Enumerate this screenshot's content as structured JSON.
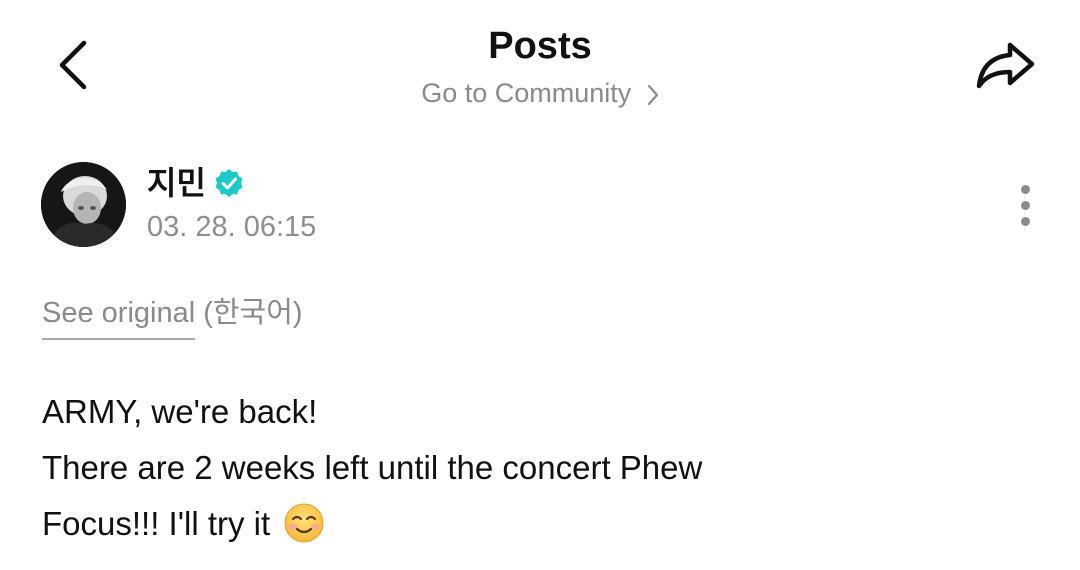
{
  "header": {
    "title": "Posts",
    "community_link": "Go to Community",
    "back_icon": "chevron-left-icon",
    "share_icon": "share-arrow-icon"
  },
  "author": {
    "name": "지민",
    "verified": true,
    "verified_color": "#1cc9c9",
    "time": "03. 28. 06:15",
    "avatar": "profile-photo"
  },
  "translation": {
    "link_label": "See original",
    "language": "(한국어)"
  },
  "post": {
    "lines": [
      "ARMY, we're back!",
      "There are 2 weeks left until the concert Phew",
      "Focus!!! I'll try it"
    ],
    "trailing_emoji": "smiling-face-emoji"
  },
  "colors": {
    "text": "#111111",
    "muted": "#8a8a8a",
    "accent": "#1cc9c9"
  }
}
